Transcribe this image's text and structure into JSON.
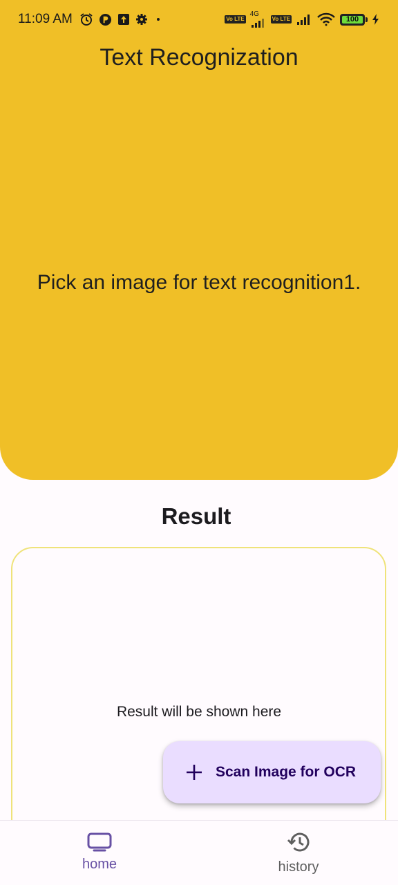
{
  "status_bar": {
    "time": "11:09 AM",
    "icons": [
      "alarm-icon",
      "app-icon",
      "upload-icon",
      "settings-icon",
      "dot-icon"
    ],
    "network_label": "4G",
    "lte_badge": "Vo LTE",
    "battery_level": "100"
  },
  "header": {
    "title": "Text Recognization"
  },
  "image_area": {
    "placeholder": "Pick an image for text recognition1."
  },
  "result": {
    "heading": "Result",
    "placeholder": "Result will be shown here"
  },
  "fab": {
    "icon": "plus-icon",
    "label": "Scan Image for OCR"
  },
  "bottom_nav": {
    "items": [
      {
        "label": "home",
        "icon": "tv-icon",
        "active": true
      },
      {
        "label": "history",
        "icon": "history-icon",
        "active": false
      }
    ]
  },
  "colors": {
    "accent_yellow": "#f0bf27",
    "fab_bg": "#eaddff",
    "active_nav": "#6750a4",
    "result_border": "#efe37a"
  }
}
